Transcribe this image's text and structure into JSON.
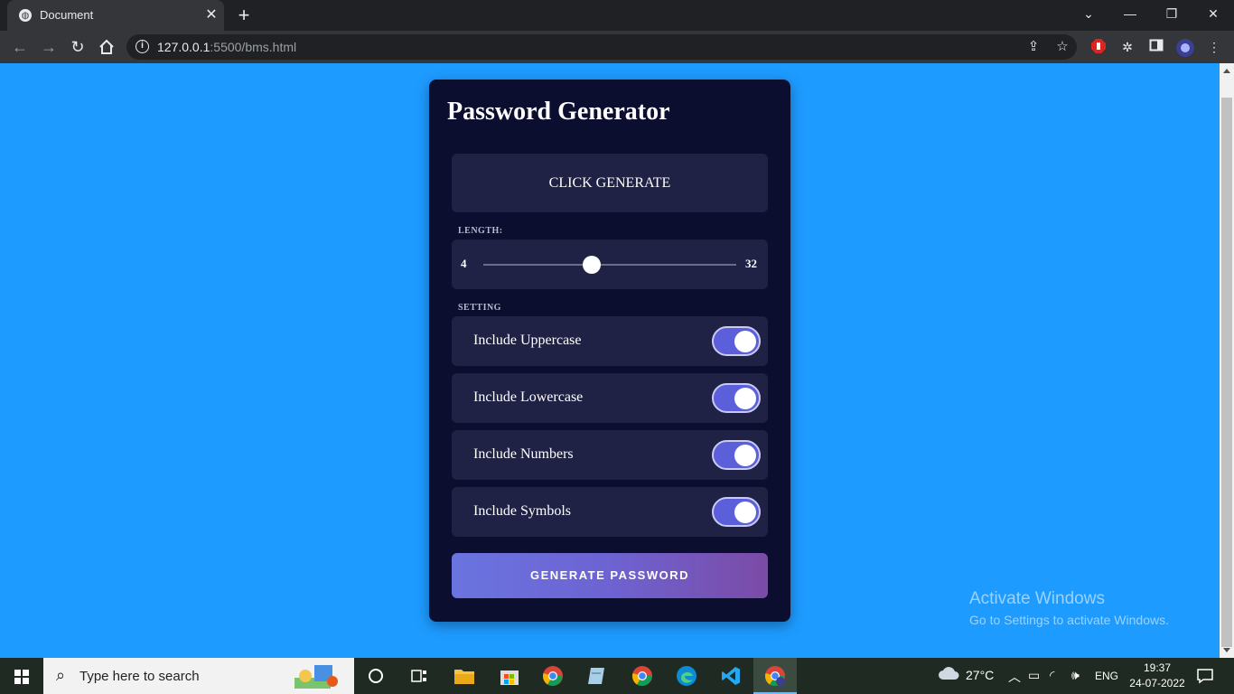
{
  "browser": {
    "tab_title": "Document",
    "tab_close": "✕",
    "new_tab": "+",
    "url_host": "127.0.0.1",
    "url_rest": ":5500/bms.html"
  },
  "app": {
    "title": "Password Generator",
    "result_text": "CLICK GENERATE",
    "length_label": "LENGTH:",
    "length_min": "4",
    "length_max": "32",
    "length_value_fraction": 0.43,
    "setting_label": "SETTING",
    "options": [
      {
        "label": "Include Uppercase",
        "enabled": true
      },
      {
        "label": "Include Lowercase",
        "enabled": true
      },
      {
        "label": "Include Numbers",
        "enabled": true
      },
      {
        "label": "Include Symbols",
        "enabled": true
      }
    ],
    "generate_label": "GENERATE PASSWORD"
  },
  "watermark": {
    "line1": "Activate Windows",
    "line2": "Go to Settings to activate Windows."
  },
  "taskbar": {
    "search_placeholder": "Type here to search",
    "temperature": "27°C",
    "language": "ENG",
    "time": "19:37",
    "date": "24-07-2022"
  },
  "colors": {
    "page_bg": "#1e9bff",
    "card_bg": "#0b0e2e",
    "panel_bg": "#1f2244",
    "toggle_on": "#5b5fd9",
    "button_gradient_start": "#6a74e0",
    "button_gradient_end": "#7b4ba6"
  }
}
